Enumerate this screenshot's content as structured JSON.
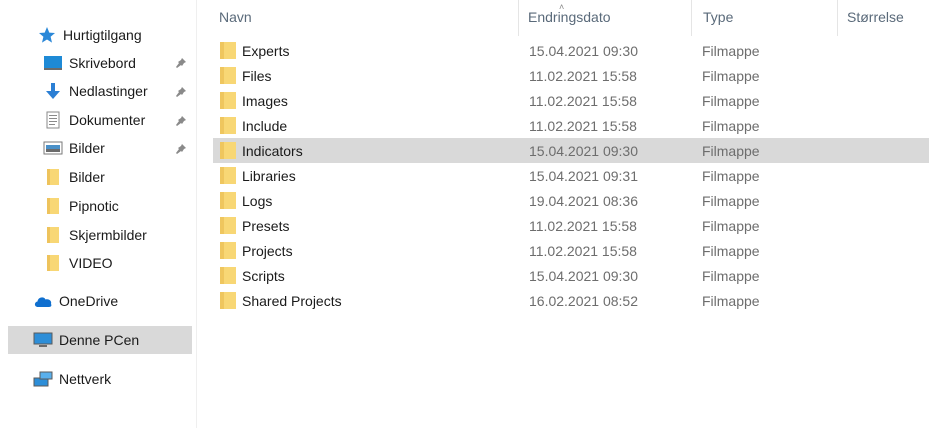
{
  "columns": {
    "name": "Navn",
    "date": "Endringsdato",
    "type": "Type",
    "size": "Størrelse"
  },
  "nav": {
    "quick_access": "Hurtigtilgang",
    "pinned": [
      {
        "label": "Skrivebord",
        "icon": "desktop-icon"
      },
      {
        "label": "Nedlastinger",
        "icon": "download-icon"
      },
      {
        "label": "Dokumenter",
        "icon": "document-icon"
      },
      {
        "label": "Bilder",
        "icon": "pictures-icon"
      }
    ],
    "recent": [
      "Bilder",
      "Pipnotic",
      "Skjermbilder",
      "VIDEO"
    ],
    "onedrive": "OneDrive",
    "this_pc": "Denne PCen",
    "network": "Nettverk"
  },
  "files": [
    {
      "name": "Experts",
      "date": "15.04.2021 09:30",
      "type": "Filmappe"
    },
    {
      "name": "Files",
      "date": "11.02.2021 15:58",
      "type": "Filmappe"
    },
    {
      "name": "Images",
      "date": "11.02.2021 15:58",
      "type": "Filmappe"
    },
    {
      "name": "Include",
      "date": "11.02.2021 15:58",
      "type": "Filmappe"
    },
    {
      "name": "Indicators",
      "date": "15.04.2021 09:30",
      "type": "Filmappe",
      "selected": true
    },
    {
      "name": "Libraries",
      "date": "15.04.2021 09:31",
      "type": "Filmappe"
    },
    {
      "name": "Logs",
      "date": "19.04.2021 08:36",
      "type": "Filmappe"
    },
    {
      "name": "Presets",
      "date": "11.02.2021 15:58",
      "type": "Filmappe"
    },
    {
      "name": "Projects",
      "date": "11.02.2021 15:58",
      "type": "Filmappe"
    },
    {
      "name": "Scripts",
      "date": "15.04.2021 09:30",
      "type": "Filmappe"
    },
    {
      "name": "Shared Projects",
      "date": "16.02.2021 08:52",
      "type": "Filmappe"
    }
  ],
  "colors": {
    "folder": "#f8d775",
    "folder_dark": "#e8b84a",
    "selection": "#d9d9d9",
    "accent": "#0078d7"
  }
}
